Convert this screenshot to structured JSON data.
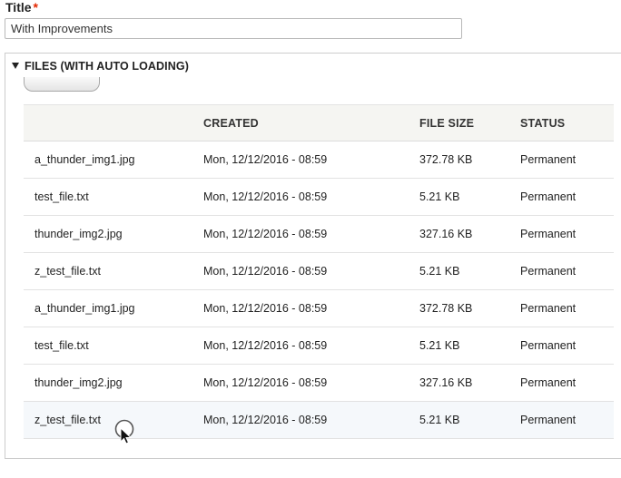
{
  "form": {
    "title_label": "Title",
    "required_mark": "*",
    "title_value": "With Improvements"
  },
  "files_section": {
    "summary": "FILES (WITH AUTO LOADING)",
    "columns": [
      "",
      "CREATED",
      "FILE SIZE",
      "STATUS"
    ],
    "rows": [
      {
        "name": "a_thunder_img1.jpg",
        "created": "Mon, 12/12/2016 - 08:59",
        "size": "372.78 KB",
        "status": "Permanent"
      },
      {
        "name": "test_file.txt",
        "created": "Mon, 12/12/2016 - 08:59",
        "size": "5.21 KB",
        "status": "Permanent"
      },
      {
        "name": "thunder_img2.jpg",
        "created": "Mon, 12/12/2016 - 08:59",
        "size": "327.16 KB",
        "status": "Permanent"
      },
      {
        "name": "z_test_file.txt",
        "created": "Mon, 12/12/2016 - 08:59",
        "size": "5.21 KB",
        "status": "Permanent"
      },
      {
        "name": "a_thunder_img1.jpg",
        "created": "Mon, 12/12/2016 - 08:59",
        "size": "372.78 KB",
        "status": "Permanent"
      },
      {
        "name": "test_file.txt",
        "created": "Mon, 12/12/2016 - 08:59",
        "size": "5.21 KB",
        "status": "Permanent"
      },
      {
        "name": "thunder_img2.jpg",
        "created": "Mon, 12/12/2016 - 08:59",
        "size": "327.16 KB",
        "status": "Permanent"
      },
      {
        "name": "z_test_file.txt",
        "created": "Mon, 12/12/2016 - 08:59",
        "size": "5.21 KB",
        "status": "Permanent"
      }
    ]
  },
  "colors": {
    "required": "#e32700",
    "header_bg": "#f5f5f2",
    "hover_row_bg": "#f5f8fb"
  },
  "icons": {
    "collapse": "triangle-down-icon",
    "cursor": "busy-cursor-icon"
  }
}
